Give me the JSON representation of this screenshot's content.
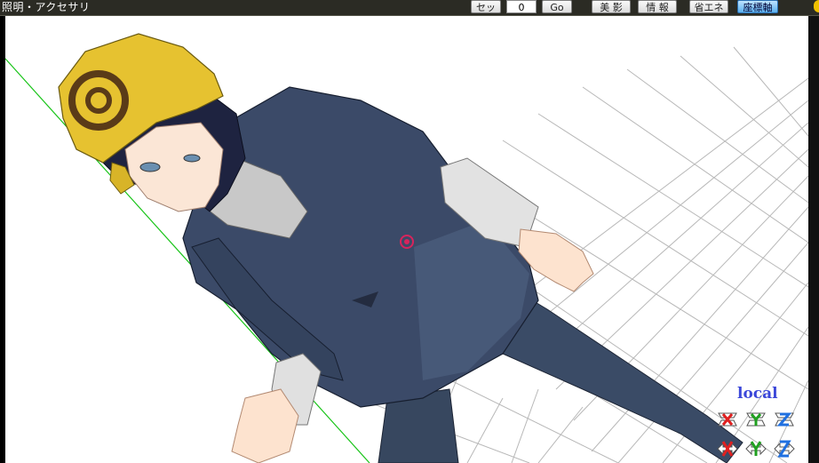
{
  "window": {
    "title": "照明・アクセサリ"
  },
  "toolbar": {
    "set_label": "セット",
    "frame_value": "0",
    "go_label": "Go",
    "bieffect_label": "美 影",
    "info_label": "情 報",
    "energysave_label": "省エネ",
    "axis_label": "座標軸"
  },
  "viewport": {
    "mode_label": "local",
    "background_color": "#ffffff",
    "grid_color": "#b0b0b0",
    "axis_line_color": "#18c418",
    "target_marker_color": "#d8245c"
  },
  "axis_controls": [
    {
      "axis": "X",
      "kind": "rotate",
      "color": "#e02020",
      "icon": "rotate-x-icon"
    },
    {
      "axis": "Y",
      "kind": "rotate",
      "color": "#20a020",
      "icon": "rotate-y-icon"
    },
    {
      "axis": "Z",
      "kind": "rotate",
      "color": "#2070e0",
      "icon": "rotate-z-icon"
    },
    {
      "axis": "X",
      "kind": "move",
      "color": "#e02020",
      "icon": "move-x-icon"
    },
    {
      "axis": "Y",
      "kind": "move",
      "color": "#20a020",
      "icon": "move-y-icon"
    },
    {
      "axis": "Z",
      "kind": "move",
      "color": "#2070e0",
      "icon": "move-z-icon"
    }
  ]
}
